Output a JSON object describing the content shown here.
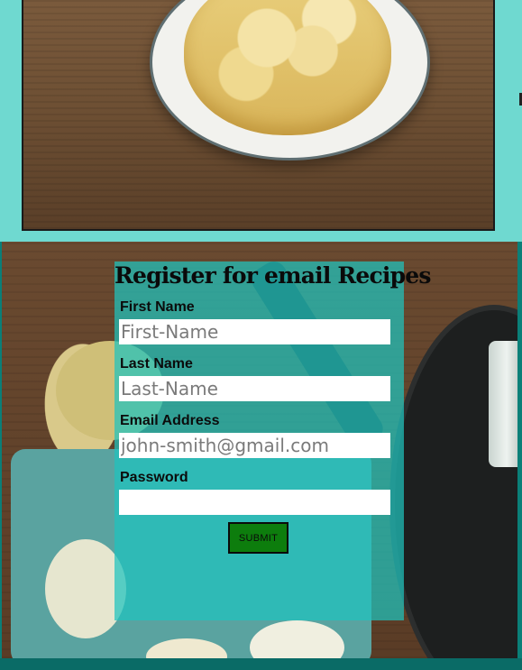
{
  "form": {
    "title": "Register for email Recipes",
    "fields": [
      {
        "label": "First Name",
        "placeholder": "First-Name",
        "value": ""
      },
      {
        "label": "Last Name",
        "placeholder": "Last-Name",
        "value": ""
      },
      {
        "label": "Email Address",
        "placeholder": "john-smith@gmail.com",
        "value": ""
      },
      {
        "label": "Password",
        "placeholder": "",
        "value": ""
      }
    ],
    "submit_label": "SUBMIT"
  },
  "colors": {
    "page_background": "#0a7f78",
    "top_border": "#6fd9d0",
    "form_overlay": "#1fc4be",
    "submit_button": "#0d7d0d"
  }
}
